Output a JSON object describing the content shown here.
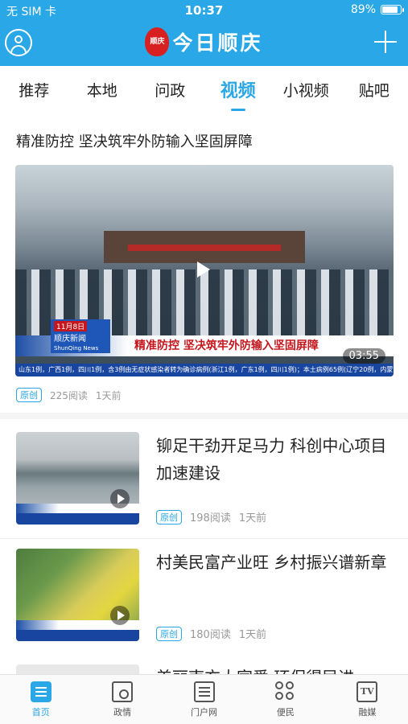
{
  "status_bar": {
    "carrier": "无 SIM 卡",
    "time": "10:37",
    "battery_text": "89%",
    "battery_level": 0.89
  },
  "app_bar": {
    "logo_seal_text": "顺庆",
    "logo_name": "今日顺庆"
  },
  "tabs": [
    {
      "label": "推荐",
      "active": false
    },
    {
      "label": "本地",
      "active": false
    },
    {
      "label": "问政",
      "active": false
    },
    {
      "label": "视频",
      "active": true
    },
    {
      "label": "小视频",
      "active": false
    },
    {
      "label": "贴吧",
      "active": false
    }
  ],
  "featured": {
    "title": "精准防控  坚决筑牢外防输入坚固屏障",
    "video_caption": "精准防控   坚决筑牢外防输入坚固屏障",
    "channel_date": "11月8日",
    "channel_name": "顺庆新闻",
    "channel_sub": "ShunQing News",
    "ticker": "山东1例，广西1例，四川1例，含3例由无症状感染者转为确诊病例(浙江1例，广东1例，四川1例)；本土病例65例(辽宁20例，内蒙古达茂",
    "duration": "03:55",
    "badge": "原创",
    "reads": "225阅读",
    "time_ago": "1天前"
  },
  "news": [
    {
      "title": "铆足干劲开足马力 科创中心项目加速建设",
      "badge": "原创",
      "reads": "198阅读",
      "time_ago": "1天前"
    },
    {
      "title": "村美民富产业旺  乡村振兴谱新章",
      "badge": "原创",
      "reads": "180阅读",
      "time_ago": "1天前"
    }
  ],
  "partial_item": {
    "title": "美丽南充大家爱  环保得民进"
  },
  "bottom_nav": [
    {
      "label": "首页",
      "icon": "home-icon",
      "active": true
    },
    {
      "label": "政情",
      "icon": "politics-icon",
      "active": false
    },
    {
      "label": "门户网",
      "icon": "portal-icon",
      "active": false
    },
    {
      "label": "便民",
      "icon": "services-icon",
      "active": false
    },
    {
      "label": "融媒",
      "icon": "tv-icon",
      "active": false
    }
  ],
  "colors": {
    "brand": "#2aa7e6",
    "seal": "#d92020"
  }
}
